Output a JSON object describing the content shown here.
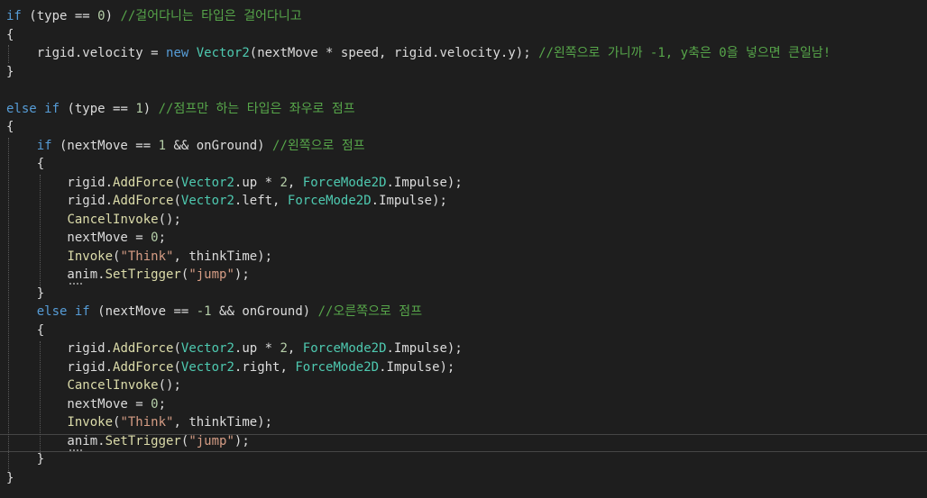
{
  "editor": {
    "lines": [
      {
        "tokens": [
          {
            "c": "kw",
            "t": "if"
          },
          {
            "c": "pl",
            "t": " (type == "
          },
          {
            "c": "num",
            "t": "0"
          },
          {
            "c": "pl",
            "t": ") "
          },
          {
            "c": "cm",
            "t": "//걸어다니는 타입은 걸어다니고"
          }
        ]
      },
      {
        "tokens": [
          {
            "c": "pl",
            "t": "{"
          }
        ]
      },
      {
        "tokens": [
          {
            "c": "pl",
            "t": "    rigid.velocity = "
          },
          {
            "c": "kw",
            "t": "new"
          },
          {
            "c": "pl",
            "t": " "
          },
          {
            "c": "ty",
            "t": "Vector2"
          },
          {
            "c": "pl",
            "t": "(nextMove * speed, rigid.velocity.y); "
          },
          {
            "c": "cm",
            "t": "//왼쪽으로 가니까 -1, y축은 0을 넣으면 큰일남!"
          }
        ]
      },
      {
        "tokens": [
          {
            "c": "pl",
            "t": "}"
          }
        ]
      },
      {
        "tokens": []
      },
      {
        "tokens": [
          {
            "c": "kw",
            "t": "else"
          },
          {
            "c": "pl",
            "t": " "
          },
          {
            "c": "kw",
            "t": "if"
          },
          {
            "c": "pl",
            "t": " (type == "
          },
          {
            "c": "num",
            "t": "1"
          },
          {
            "c": "pl",
            "t": ") "
          },
          {
            "c": "cm",
            "t": "//점프만 하는 타입은 좌우로 점프"
          }
        ]
      },
      {
        "tokens": [
          {
            "c": "pl",
            "t": "{"
          }
        ]
      },
      {
        "tokens": [
          {
            "c": "pl",
            "t": "    "
          },
          {
            "c": "kw",
            "t": "if"
          },
          {
            "c": "pl",
            "t": " (nextMove == "
          },
          {
            "c": "num",
            "t": "1"
          },
          {
            "c": "pl",
            "t": " && onGround) "
          },
          {
            "c": "cm",
            "t": "//왼쪽으로 점프"
          }
        ]
      },
      {
        "tokens": [
          {
            "c": "pl",
            "t": "    {"
          }
        ]
      },
      {
        "tokens": [
          {
            "c": "pl",
            "t": "        rigid."
          },
          {
            "c": "mt",
            "t": "AddForce"
          },
          {
            "c": "pl",
            "t": "("
          },
          {
            "c": "ty",
            "t": "Vector2"
          },
          {
            "c": "pl",
            "t": ".up * "
          },
          {
            "c": "num",
            "t": "2"
          },
          {
            "c": "pl",
            "t": ", "
          },
          {
            "c": "ty",
            "t": "ForceMode2D"
          },
          {
            "c": "pl",
            "t": ".Impulse);"
          }
        ]
      },
      {
        "tokens": [
          {
            "c": "pl",
            "t": "        rigid."
          },
          {
            "c": "mt",
            "t": "AddForce"
          },
          {
            "c": "pl",
            "t": "("
          },
          {
            "c": "ty",
            "t": "Vector2"
          },
          {
            "c": "pl",
            "t": ".left, "
          },
          {
            "c": "ty",
            "t": "ForceMode2D"
          },
          {
            "c": "pl",
            "t": ".Impulse);"
          }
        ]
      },
      {
        "tokens": [
          {
            "c": "pl",
            "t": "        "
          },
          {
            "c": "mt",
            "t": "CancelInvoke"
          },
          {
            "c": "pl",
            "t": "();"
          }
        ]
      },
      {
        "tokens": [
          {
            "c": "pl",
            "t": "        nextMove = "
          },
          {
            "c": "num",
            "t": "0"
          },
          {
            "c": "pl",
            "t": ";"
          }
        ]
      },
      {
        "tokens": [
          {
            "c": "pl",
            "t": "        "
          },
          {
            "c": "mt",
            "t": "Invoke"
          },
          {
            "c": "pl",
            "t": "("
          },
          {
            "c": "str",
            "t": "\"Think\""
          },
          {
            "c": "pl",
            "t": ", thinkTime);"
          }
        ]
      },
      {
        "tokens": [
          {
            "c": "pl",
            "t": "        anim."
          },
          {
            "c": "mt",
            "t": "SetTrigger"
          },
          {
            "c": "pl",
            "t": "("
          },
          {
            "c": "str",
            "t": "\"jump\""
          },
          {
            "c": "pl",
            "t": ");"
          }
        ]
      },
      {
        "tokens": [
          {
            "c": "pl",
            "t": "    }"
          }
        ]
      },
      {
        "tokens": [
          {
            "c": "pl",
            "t": "    "
          },
          {
            "c": "kw",
            "t": "else"
          },
          {
            "c": "pl",
            "t": " "
          },
          {
            "c": "kw",
            "t": "if"
          },
          {
            "c": "pl",
            "t": " (nextMove == "
          },
          {
            "c": "num",
            "t": "-1"
          },
          {
            "c": "pl",
            "t": " && onGround) "
          },
          {
            "c": "cm",
            "t": "//오른쪽으로 점프"
          }
        ]
      },
      {
        "tokens": [
          {
            "c": "pl",
            "t": "    {"
          }
        ]
      },
      {
        "tokens": [
          {
            "c": "pl",
            "t": "        rigid."
          },
          {
            "c": "mt",
            "t": "AddForce"
          },
          {
            "c": "pl",
            "t": "("
          },
          {
            "c": "ty",
            "t": "Vector2"
          },
          {
            "c": "pl",
            "t": ".up * "
          },
          {
            "c": "num",
            "t": "2"
          },
          {
            "c": "pl",
            "t": ", "
          },
          {
            "c": "ty",
            "t": "ForceMode2D"
          },
          {
            "c": "pl",
            "t": ".Impulse);"
          }
        ]
      },
      {
        "tokens": [
          {
            "c": "pl",
            "t": "        rigid."
          },
          {
            "c": "mt",
            "t": "AddForce"
          },
          {
            "c": "pl",
            "t": "("
          },
          {
            "c": "ty",
            "t": "Vector2"
          },
          {
            "c": "pl",
            "t": ".right, "
          },
          {
            "c": "ty",
            "t": "ForceMode2D"
          },
          {
            "c": "pl",
            "t": ".Impulse);"
          }
        ]
      },
      {
        "tokens": [
          {
            "c": "pl",
            "t": "        "
          },
          {
            "c": "mt",
            "t": "CancelInvoke"
          },
          {
            "c": "pl",
            "t": "();"
          }
        ]
      },
      {
        "tokens": [
          {
            "c": "pl",
            "t": "        nextMove = "
          },
          {
            "c": "num",
            "t": "0"
          },
          {
            "c": "pl",
            "t": ";"
          }
        ]
      },
      {
        "tokens": [
          {
            "c": "pl",
            "t": "        "
          },
          {
            "c": "mt",
            "t": "Invoke"
          },
          {
            "c": "pl",
            "t": "("
          },
          {
            "c": "str",
            "t": "\"Think\""
          },
          {
            "c": "pl",
            "t": ", thinkTime);"
          }
        ]
      },
      {
        "tokens": [
          {
            "c": "pl",
            "t": "        anim."
          },
          {
            "c": "mt",
            "t": "SetTrigger"
          },
          {
            "c": "pl",
            "t": "("
          },
          {
            "c": "str",
            "t": "\"jump\""
          },
          {
            "c": "pl",
            "t": ");"
          }
        ]
      },
      {
        "tokens": [
          {
            "c": "pl",
            "t": "    }"
          }
        ]
      },
      {
        "tokens": [
          {
            "c": "pl",
            "t": "}"
          }
        ]
      }
    ],
    "current_line": 24,
    "squiggle_lines": [
      14,
      23
    ],
    "colors": {
      "background": "#1e1e1e",
      "keyword": "#569cd6",
      "control": "#d8a0df",
      "type": "#4ec9b0",
      "method": "#dcdcaa",
      "number": "#b5cea8",
      "string": "#d69d85",
      "comment": "#57a64a",
      "plain": "#dcdcdc"
    }
  }
}
